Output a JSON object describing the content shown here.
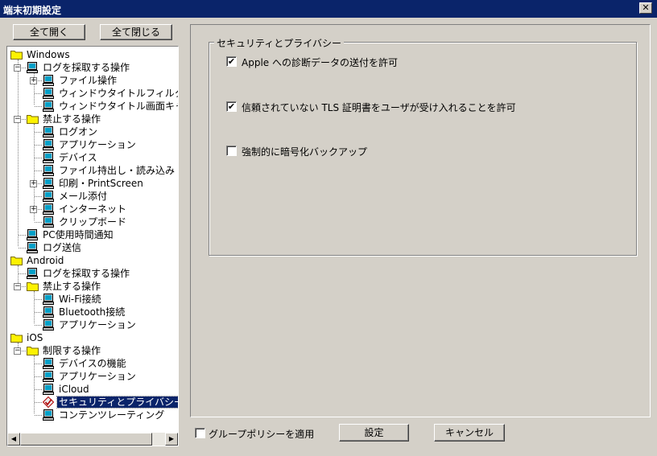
{
  "window": {
    "title": "端末初期設定",
    "close_glyph": "✕"
  },
  "toolbar": {
    "expand_all": "全て開く",
    "collapse_all": "全て閉じる"
  },
  "tree": {
    "items": [
      {
        "label": "Windows",
        "icon": "folder-icon",
        "level": 0,
        "expander": null
      },
      {
        "label": "ログを採取する操作",
        "icon": "computer-icon",
        "level": 1,
        "expander": "-"
      },
      {
        "label": "ファイル操作",
        "icon": "computer-icon",
        "level": 2,
        "expander": "+"
      },
      {
        "label": "ウィンドウタイトルフィルタ",
        "icon": "computer-icon",
        "level": 2,
        "expander": null
      },
      {
        "label": "ウィンドウタイトル画面キャプチャ",
        "icon": "computer-icon",
        "level": 2,
        "expander": null
      },
      {
        "label": "禁止する操作",
        "icon": "folder-icon",
        "level": 1,
        "expander": "-"
      },
      {
        "label": "ログオン",
        "icon": "computer-icon",
        "level": 2,
        "expander": null
      },
      {
        "label": "アプリケーション",
        "icon": "computer-icon",
        "level": 2,
        "expander": null
      },
      {
        "label": "デバイス",
        "icon": "computer-icon",
        "level": 2,
        "expander": null
      },
      {
        "label": "ファイル持出し・読み込み",
        "icon": "computer-icon",
        "level": 2,
        "expander": null
      },
      {
        "label": "印刷・PrintScreen",
        "icon": "computer-icon",
        "level": 2,
        "expander": "+"
      },
      {
        "label": "メール添付",
        "icon": "computer-icon",
        "level": 2,
        "expander": null
      },
      {
        "label": "インターネット",
        "icon": "computer-icon",
        "level": 2,
        "expander": "+"
      },
      {
        "label": "クリップボード",
        "icon": "computer-icon",
        "level": 2,
        "expander": null
      },
      {
        "label": "PC使用時間通知",
        "icon": "computer-icon",
        "level": 1,
        "expander": null
      },
      {
        "label": "ログ送信",
        "icon": "computer-icon",
        "level": 1,
        "expander": null
      },
      {
        "label": "Android",
        "icon": "folder-icon",
        "level": 0,
        "expander": null
      },
      {
        "label": "ログを採取する操作",
        "icon": "computer-icon",
        "level": 1,
        "expander": null
      },
      {
        "label": "禁止する操作",
        "icon": "folder-icon",
        "level": 1,
        "expander": "-"
      },
      {
        "label": "Wi-Fi接続",
        "icon": "computer-icon",
        "level": 2,
        "expander": null
      },
      {
        "label": "Bluetooth接続",
        "icon": "computer-icon",
        "level": 2,
        "expander": null
      },
      {
        "label": "アプリケーション",
        "icon": "computer-icon",
        "level": 2,
        "expander": null
      },
      {
        "label": "iOS",
        "icon": "folder-icon",
        "level": 0,
        "expander": null
      },
      {
        "label": "制限する操作",
        "icon": "folder-icon",
        "level": 1,
        "expander": "-"
      },
      {
        "label": "デバイスの機能",
        "icon": "computer-icon",
        "level": 2,
        "expander": null
      },
      {
        "label": "アプリケーション",
        "icon": "computer-icon",
        "level": 2,
        "expander": null
      },
      {
        "label": "iCloud",
        "icon": "computer-icon",
        "level": 2,
        "expander": null
      },
      {
        "label": "セキュリティとプライバシー",
        "icon": "checked-diamond-icon",
        "level": 2,
        "expander": null,
        "selected": true
      },
      {
        "label": "コンテンツレーティング",
        "icon": "computer-icon",
        "level": 2,
        "expander": null
      }
    ]
  },
  "scrollbar": {
    "left_glyph": "◀",
    "right_glyph": "▶"
  },
  "panel": {
    "group_title": "セキュリティとプライバシー",
    "options": [
      {
        "label": "Apple への診断データの送付を許可",
        "checked": true
      },
      {
        "label": "信頼されていない TLS 証明書をユーザが受け入れることを許可",
        "checked": true
      },
      {
        "label": "強制的に暗号化バックアップ",
        "checked": false
      }
    ]
  },
  "footer": {
    "group_policy_label": "グループポリシーを適用",
    "group_policy_checked": false,
    "ok_label": "設定",
    "cancel_label": "キャンセル"
  },
  "check_glyph": "✔",
  "colors": {
    "title_bar": "#0a246a",
    "selection": "#0a246a",
    "face": "#d4d0c8"
  }
}
